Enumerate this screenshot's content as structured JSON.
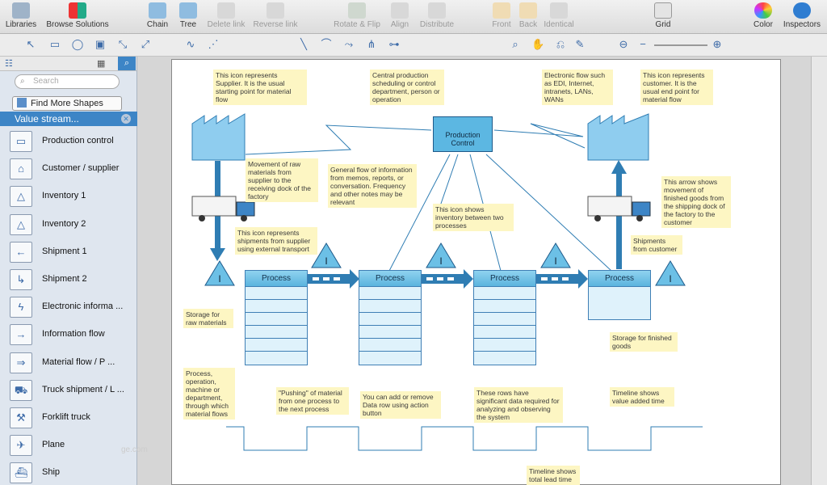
{
  "toolbar": {
    "libraries": "Libraries",
    "browse": "Browse Solutions",
    "chain": "Chain",
    "tree": "Tree",
    "delete_link": "Delete link",
    "reverse_link": "Reverse link",
    "rotate_flip": "Rotate & Flip",
    "align": "Align",
    "distribute": "Distribute",
    "front": "Front",
    "back": "Back",
    "identical": "Identical",
    "grid": "Grid",
    "color": "Color",
    "inspectors": "Inspectors"
  },
  "sidebar": {
    "search_placeholder": "Search",
    "find_more": "Find More Shapes",
    "library_name": "Value stream...",
    "items": [
      {
        "label": "Production control",
        "icon": "rect-icon"
      },
      {
        "label": "Customer / supplier",
        "icon": "factory-icon"
      },
      {
        "label": "Inventory 1",
        "icon": "inventory-icon"
      },
      {
        "label": "Inventory 2",
        "icon": "inventory-icon"
      },
      {
        "label": "Shipment 1",
        "icon": "arrow-left-icon"
      },
      {
        "label": "Shipment 2",
        "icon": "elbow-arrow-icon"
      },
      {
        "label": "Electronic informa ...",
        "icon": "lightning-icon"
      },
      {
        "label": "Information flow",
        "icon": "arrow-icon"
      },
      {
        "label": "Material flow / P ...",
        "icon": "push-arrow-icon"
      },
      {
        "label": "Truck shipment / L ...",
        "icon": "truck-icon"
      },
      {
        "label": "Forklift truck",
        "icon": "forklift-icon"
      },
      {
        "label": "Plane",
        "icon": "plane-icon"
      },
      {
        "label": "Ship",
        "icon": "ship-icon"
      }
    ]
  },
  "diagram": {
    "production_control": "Production Control",
    "process_label": "Process",
    "notes": {
      "supplier": "This icon represents Supplier. It is the usual starting point for material flow",
      "central": "Central production scheduling or control department, person or operation",
      "electronic": "Electronic flow such as EDI, Internet, intranets, LANs, WANs",
      "customer": "This icon represents customer. It is the usual end point for material flow",
      "movement_raw": "Movement of raw materials from supplier to the receiving dock of the factory",
      "general_flow": "General flow of information from memos, reports, or conversation. Frequency and other notes may be relevant",
      "inventory": "This icon shows inventory between two processes",
      "arrow_finished": "This arrow shows movement of finished goods from the shipping dock of the factory to the customer",
      "shipments_supplier": "This icon represents shipments from supplier using external transport",
      "shipments_customer": "Shipments from customer",
      "storage_raw": "Storage for raw materials",
      "storage_finished": "Storage for finished goods",
      "process_op": "Process, operation, machine or department, through which material flows",
      "pushing": "\"Pushing\" of material from one process to the next process",
      "data_row": "You can add or remove Data row using action button",
      "rows_significant": "These rows have significant data required for analyzing and observing the system",
      "timeline_value": "Timeline shows value added time",
      "timeline_total": "Timeline shows total lead time"
    }
  },
  "colors": {
    "accent": "#3d85c6",
    "process_fill": "#5bb4de",
    "note": "#fdf6c3",
    "arrow": "#2f7db3"
  },
  "watermark": "ge.com"
}
